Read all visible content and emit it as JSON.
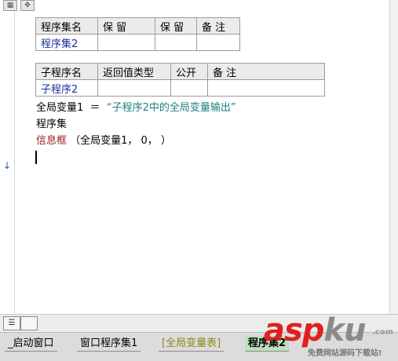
{
  "colors": {
    "header_bg": "#ebebeb",
    "cell_text": "#1a2f9e",
    "string_literal": "#1f7f7f",
    "command": "#9a1b1b",
    "active_tab": "#bfe0bf",
    "globals_tab": "#8a8a1a",
    "watermark_red": "#e02020"
  },
  "assembly_table": {
    "headers": [
      "程序集名",
      "保 留",
      "保 留",
      "备 注"
    ],
    "row": [
      "程序集2",
      "",
      "",
      ""
    ]
  },
  "subroutine_table": {
    "headers": [
      "子程序名",
      "返回值类型",
      "公开",
      "备 注"
    ],
    "row": [
      "子程序2",
      "",
      "",
      ""
    ]
  },
  "code": {
    "line1_var": "全局变量1",
    "line1_op": "＝",
    "line1_str": "“子程序2中的全局变量输出”",
    "line2": "程序集",
    "line3_cmd": "信息框",
    "line3_args": "（全局变量1， 0， ）"
  },
  "tabs": [
    {
      "label": "_启动窗口"
    },
    {
      "label": "窗口程序集1"
    },
    {
      "label": "[全局变量表]"
    },
    {
      "label": "程序集2"
    }
  ],
  "watermark": {
    "brand_a": "asp",
    "brand_b": "ku",
    "domain": ".com",
    "tagline": "免费网站源码下载站!"
  },
  "icons": {
    "corner1": "grid-icon",
    "corner2": "move-icon",
    "gutter": "down-arrow-icon",
    "view": "list-view-icon"
  }
}
